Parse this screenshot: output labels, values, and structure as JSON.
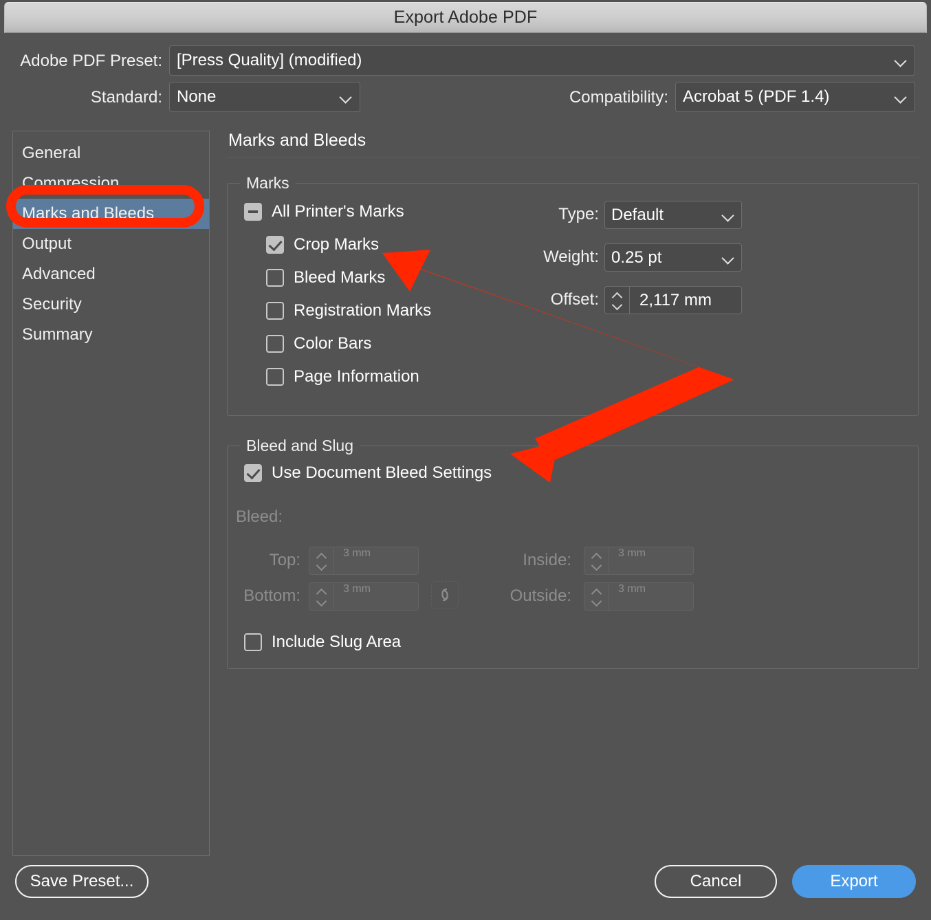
{
  "window": {
    "title": "Export Adobe PDF"
  },
  "top": {
    "preset_label": "Adobe PDF Preset:",
    "preset_value": "[Press Quality] (modified)",
    "standard_label": "Standard:",
    "standard_value": "None",
    "compatibility_label": "Compatibility:",
    "compatibility_value": "Acrobat 5 (PDF 1.4)"
  },
  "sidebar": {
    "items": [
      {
        "label": "General",
        "selected": false
      },
      {
        "label": "Compression",
        "selected": false
      },
      {
        "label": "Marks and Bleeds",
        "selected": true
      },
      {
        "label": "Output",
        "selected": false
      },
      {
        "label": "Advanced",
        "selected": false
      },
      {
        "label": "Security",
        "selected": false
      },
      {
        "label": "Summary",
        "selected": false
      }
    ]
  },
  "main": {
    "panel_title": "Marks and Bleeds",
    "marks": {
      "legend": "Marks",
      "all_printers_marks": {
        "label": "All Printer's Marks",
        "state": "mixed"
      },
      "checkboxes": [
        {
          "label": "Crop Marks",
          "state": "checked"
        },
        {
          "label": "Bleed Marks",
          "state": "unchecked"
        },
        {
          "label": "Registration Marks",
          "state": "unchecked"
        },
        {
          "label": "Color Bars",
          "state": "unchecked"
        },
        {
          "label": "Page Information",
          "state": "unchecked"
        }
      ],
      "type_label": "Type:",
      "type_value": "Default",
      "weight_label": "Weight:",
      "weight_value": "0.25 pt",
      "offset_label": "Offset:",
      "offset_value": "2,117 mm"
    },
    "bleed": {
      "legend": "Bleed and Slug",
      "use_document_bleed": {
        "label": "Use Document Bleed Settings",
        "state": "checked"
      },
      "bleed_label": "Bleed:",
      "fields": [
        {
          "label": "Top:",
          "value": "3 mm"
        },
        {
          "label": "Bottom:",
          "value": "3 mm"
        },
        {
          "label": "Inside:",
          "value": "3 mm"
        },
        {
          "label": "Outside:",
          "value": "3 mm"
        }
      ],
      "chain_icon": "link-icon",
      "include_slug": {
        "label": "Include Slug Area",
        "state": "unchecked"
      }
    }
  },
  "footer": {
    "save_preset_label": "Save Preset...",
    "cancel_label": "Cancel",
    "export_label": "Export"
  },
  "annotations": {
    "highlight_color": "#FF2600",
    "highlight_target": "Marks and Bleeds",
    "arrow_targets": [
      "Crop Marks",
      "Use Document Bleed Settings"
    ]
  },
  "colors": {
    "dialog_bg": "#535353",
    "selection_blue": "#5C7C9E",
    "export_blue": "#4A9AE8",
    "annotation_red": "#FF2600"
  }
}
